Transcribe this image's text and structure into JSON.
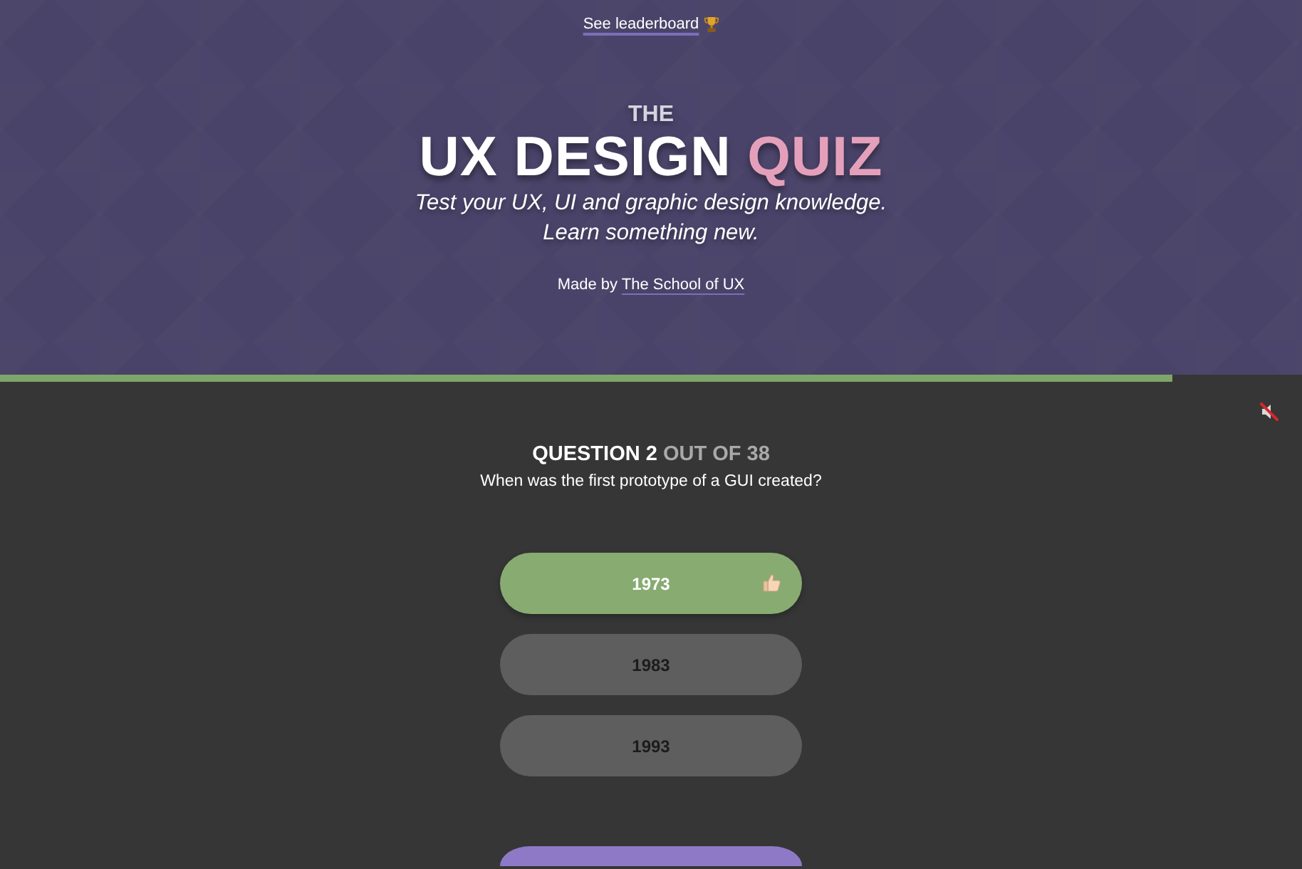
{
  "header": {
    "leaderboard_link": "See leaderboard",
    "title_prefix": "THE",
    "title_main": "UX DESIGN",
    "title_accent": "QUIZ",
    "subtitle": [
      "Test your UX, UI and graphic design knowledge.",
      "Learn something new."
    ],
    "credit": {
      "text": "Made by",
      "link": "The School of UX"
    }
  },
  "progress": {
    "level": 0.9
  },
  "sound": {
    "muted": true
  },
  "question": {
    "label": "QUESTION 2",
    "total": "OUT OF 38",
    "text": "When was the first prototype of a GUI created?"
  },
  "answers": [
    {
      "label": "1973",
      "selected": true,
      "disabled": false
    },
    {
      "label": "1983",
      "selected": false,
      "disabled": true
    },
    {
      "label": "1993",
      "selected": false,
      "disabled": true
    }
  ]
}
